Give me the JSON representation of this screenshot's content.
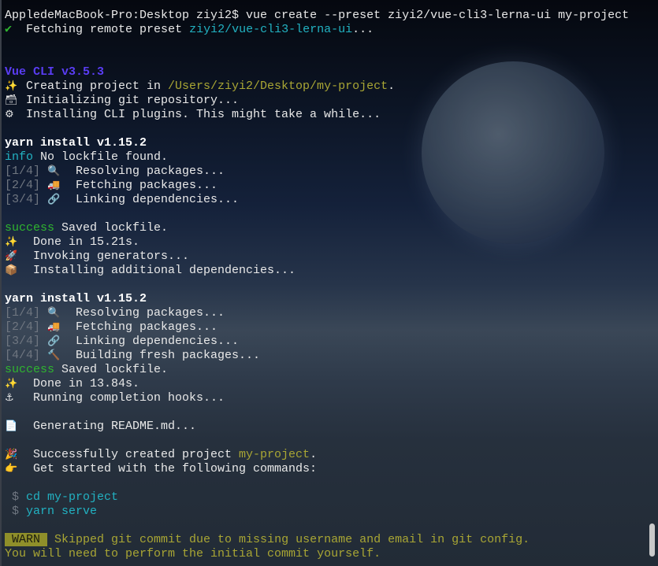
{
  "colors": {
    "cyan": "#22b2c2",
    "yellow": "#a9a634",
    "purple": "#5a3df5",
    "green": "#2fb52f",
    "gray": "#6f7680"
  },
  "lines": [
    [
      {
        "t": "AppledeMacBook-Pro:Desktop ziyi2$ vue create --preset ziyi2/vue-cli3-lerna-ui my-project",
        "c": "w"
      }
    ],
    [
      {
        "t": "✔",
        "c": "ck",
        "i": "checkmark-icon"
      },
      {
        "t": "  Fetching remote preset ",
        "c": "w"
      },
      {
        "t": "ziyi2/vue-cli3-lerna-ui",
        "c": "cy"
      },
      {
        "t": "...",
        "c": "w"
      }
    ],
    [],
    [],
    [
      {
        "t": "Vue CLI v3.5.3",
        "c": "pu"
      }
    ],
    [
      {
        "t": "✨",
        "c": "icon",
        "i": "sparkles-icon"
      },
      {
        "t": "Creating project in ",
        "c": "w"
      },
      {
        "t": "/Users/ziyi2/Desktop/my-project",
        "c": "ye"
      },
      {
        "t": ".",
        "c": "w"
      }
    ],
    [
      {
        "t": "🗃",
        "c": "icon",
        "i": "card-file-box-icon"
      },
      {
        "t": "Initializing git repository...",
        "c": "w"
      }
    ],
    [
      {
        "t": "⚙",
        "c": "icon",
        "i": "gear-icon"
      },
      {
        "t": "Installing CLI plugins. This might take a while...",
        "c": "w"
      }
    ],
    [],
    [
      {
        "t": "yarn install v1.15.2",
        "c": "b"
      }
    ],
    [
      {
        "t": "info",
        "c": "cy"
      },
      {
        "t": " No lockfile found.",
        "c": "w"
      }
    ],
    [
      {
        "t": "[1/4] ",
        "c": "gy"
      },
      {
        "t": "🔍",
        "c": "icon",
        "i": "magnifier-icon"
      },
      {
        "t": " Resolving packages...",
        "c": "w"
      }
    ],
    [
      {
        "t": "[2/4] ",
        "c": "gy"
      },
      {
        "t": "🚚",
        "c": "icon",
        "i": "truck-icon"
      },
      {
        "t": " Fetching packages...",
        "c": "w"
      }
    ],
    [
      {
        "t": "[3/4] ",
        "c": "gy"
      },
      {
        "t": "🔗",
        "c": "icon",
        "i": "link-icon"
      },
      {
        "t": " Linking dependencies...",
        "c": "w"
      }
    ],
    [],
    [
      {
        "t": "success",
        "c": "gr"
      },
      {
        "t": " Saved lockfile.",
        "c": "w"
      }
    ],
    [
      {
        "t": "✨",
        "c": "icon",
        "i": "sparkles-icon"
      },
      {
        "t": " Done in 15.21s.",
        "c": "w"
      }
    ],
    [
      {
        "t": "🚀",
        "c": "icon",
        "i": "rocket-icon"
      },
      {
        "t": " Invoking generators...",
        "c": "w"
      }
    ],
    [
      {
        "t": "📦",
        "c": "icon",
        "i": "package-icon"
      },
      {
        "t": " Installing additional dependencies...",
        "c": "w"
      }
    ],
    [],
    [
      {
        "t": "yarn install v1.15.2",
        "c": "b"
      }
    ],
    [
      {
        "t": "[1/4] ",
        "c": "gy"
      },
      {
        "t": "🔍",
        "c": "icon",
        "i": "magnifier-icon"
      },
      {
        "t": " Resolving packages...",
        "c": "w"
      }
    ],
    [
      {
        "t": "[2/4] ",
        "c": "gy"
      },
      {
        "t": "🚚",
        "c": "icon",
        "i": "truck-icon"
      },
      {
        "t": " Fetching packages...",
        "c": "w"
      }
    ],
    [
      {
        "t": "[3/4] ",
        "c": "gy"
      },
      {
        "t": "🔗",
        "c": "icon",
        "i": "link-icon"
      },
      {
        "t": " Linking dependencies...",
        "c": "w"
      }
    ],
    [
      {
        "t": "[4/4] ",
        "c": "gy"
      },
      {
        "t": "🔨",
        "c": "icon",
        "i": "hammer-icon"
      },
      {
        "t": " Building fresh packages...",
        "c": "w"
      }
    ],
    [
      {
        "t": "success",
        "c": "gr"
      },
      {
        "t": " Saved lockfile.",
        "c": "w"
      }
    ],
    [
      {
        "t": "✨",
        "c": "icon",
        "i": "sparkles-icon"
      },
      {
        "t": " Done in 13.84s.",
        "c": "w"
      }
    ],
    [
      {
        "t": "⚓",
        "c": "icon",
        "i": "anchor-icon"
      },
      {
        "t": " Running completion hooks...",
        "c": "w"
      }
    ],
    [],
    [
      {
        "t": "📄",
        "c": "icon",
        "i": "document-icon"
      },
      {
        "t": " Generating README.md...",
        "c": "w"
      }
    ],
    [],
    [
      {
        "t": "🎉",
        "c": "icon",
        "i": "party-popper-icon"
      },
      {
        "t": " Successfully created project ",
        "c": "w"
      },
      {
        "t": "my-project",
        "c": "ye"
      },
      {
        "t": ".",
        "c": "w"
      }
    ],
    [
      {
        "t": "👉",
        "c": "icon",
        "i": "pointing-hand-icon"
      },
      {
        "t": " Get started with the following commands:",
        "c": "w"
      }
    ],
    [],
    [
      {
        "t": " $ ",
        "c": "gy"
      },
      {
        "t": "cd my-project",
        "c": "cy"
      }
    ],
    [
      {
        "t": " $ ",
        "c": "gy"
      },
      {
        "t": "yarn serve",
        "c": "cy"
      }
    ],
    [],
    [
      {
        "t": " WARN ",
        "c": "warn"
      },
      {
        "t": " Skipped git commit due to missing username and email in git config.",
        "c": "ye"
      }
    ],
    [
      {
        "t": "You will need to perform the initial commit yourself.",
        "c": "ye"
      }
    ]
  ]
}
